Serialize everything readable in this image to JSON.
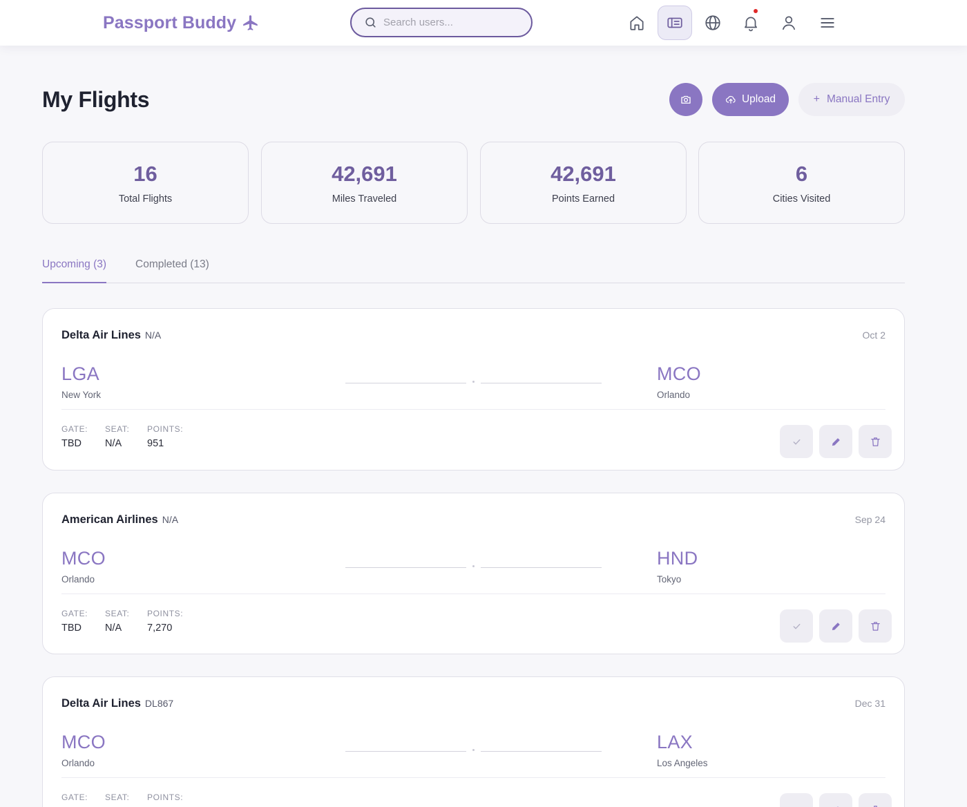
{
  "app": {
    "brand": "Passport Buddy",
    "search_placeholder": "Search users..."
  },
  "nav": {
    "items": [
      {
        "name": "home-icon",
        "active": false
      },
      {
        "name": "boarding-pass-icon",
        "active": true
      },
      {
        "name": "globe-icon",
        "active": false
      },
      {
        "name": "bell-icon",
        "active": false,
        "has_notification": true
      },
      {
        "name": "user-icon",
        "active": false
      },
      {
        "name": "menu-icon",
        "active": false
      }
    ]
  },
  "header": {
    "title": "My Flights",
    "upload_label": "Upload",
    "manual_label": "Manual Entry"
  },
  "stats": [
    {
      "value": "16",
      "label": "Total Flights"
    },
    {
      "value": "42,691",
      "label": "Miles Traveled"
    },
    {
      "value": "42,691",
      "label": "Points Earned"
    },
    {
      "value": "6",
      "label": "Cities Visited"
    }
  ],
  "tabs": [
    {
      "label": "Upcoming (3)",
      "active": true
    },
    {
      "label": "Completed (13)",
      "active": false
    }
  ],
  "meta_labels": {
    "gate": "GATE:",
    "seat": "SEAT:",
    "points": "POINTS:"
  },
  "flights": [
    {
      "airline": "Delta Air Lines",
      "flight_no": "N/A",
      "date": "Oct 2",
      "from_code": "LGA",
      "from_city": "New York",
      "to_code": "MCO",
      "to_city": "Orlando",
      "gate": "TBD",
      "seat": "N/A",
      "points": "951"
    },
    {
      "airline": "American Airlines",
      "flight_no": "N/A",
      "date": "Sep 24",
      "from_code": "MCO",
      "from_city": "Orlando",
      "to_code": "HND",
      "to_city": "Tokyo",
      "gate": "TBD",
      "seat": "N/A",
      "points": "7,270"
    },
    {
      "airline": "Delta Air Lines",
      "flight_no": "DL867",
      "date": "Dec 31",
      "from_code": "MCO",
      "from_city": "Orlando",
      "to_code": "LAX",
      "to_city": "Los Angeles",
      "gate": "",
      "seat": "",
      "points": ""
    }
  ],
  "colors": {
    "accent": "#8a76c2",
    "accent_dark": "#6f5e9e",
    "background": "#f7f7fa",
    "notification": "#e02828"
  }
}
